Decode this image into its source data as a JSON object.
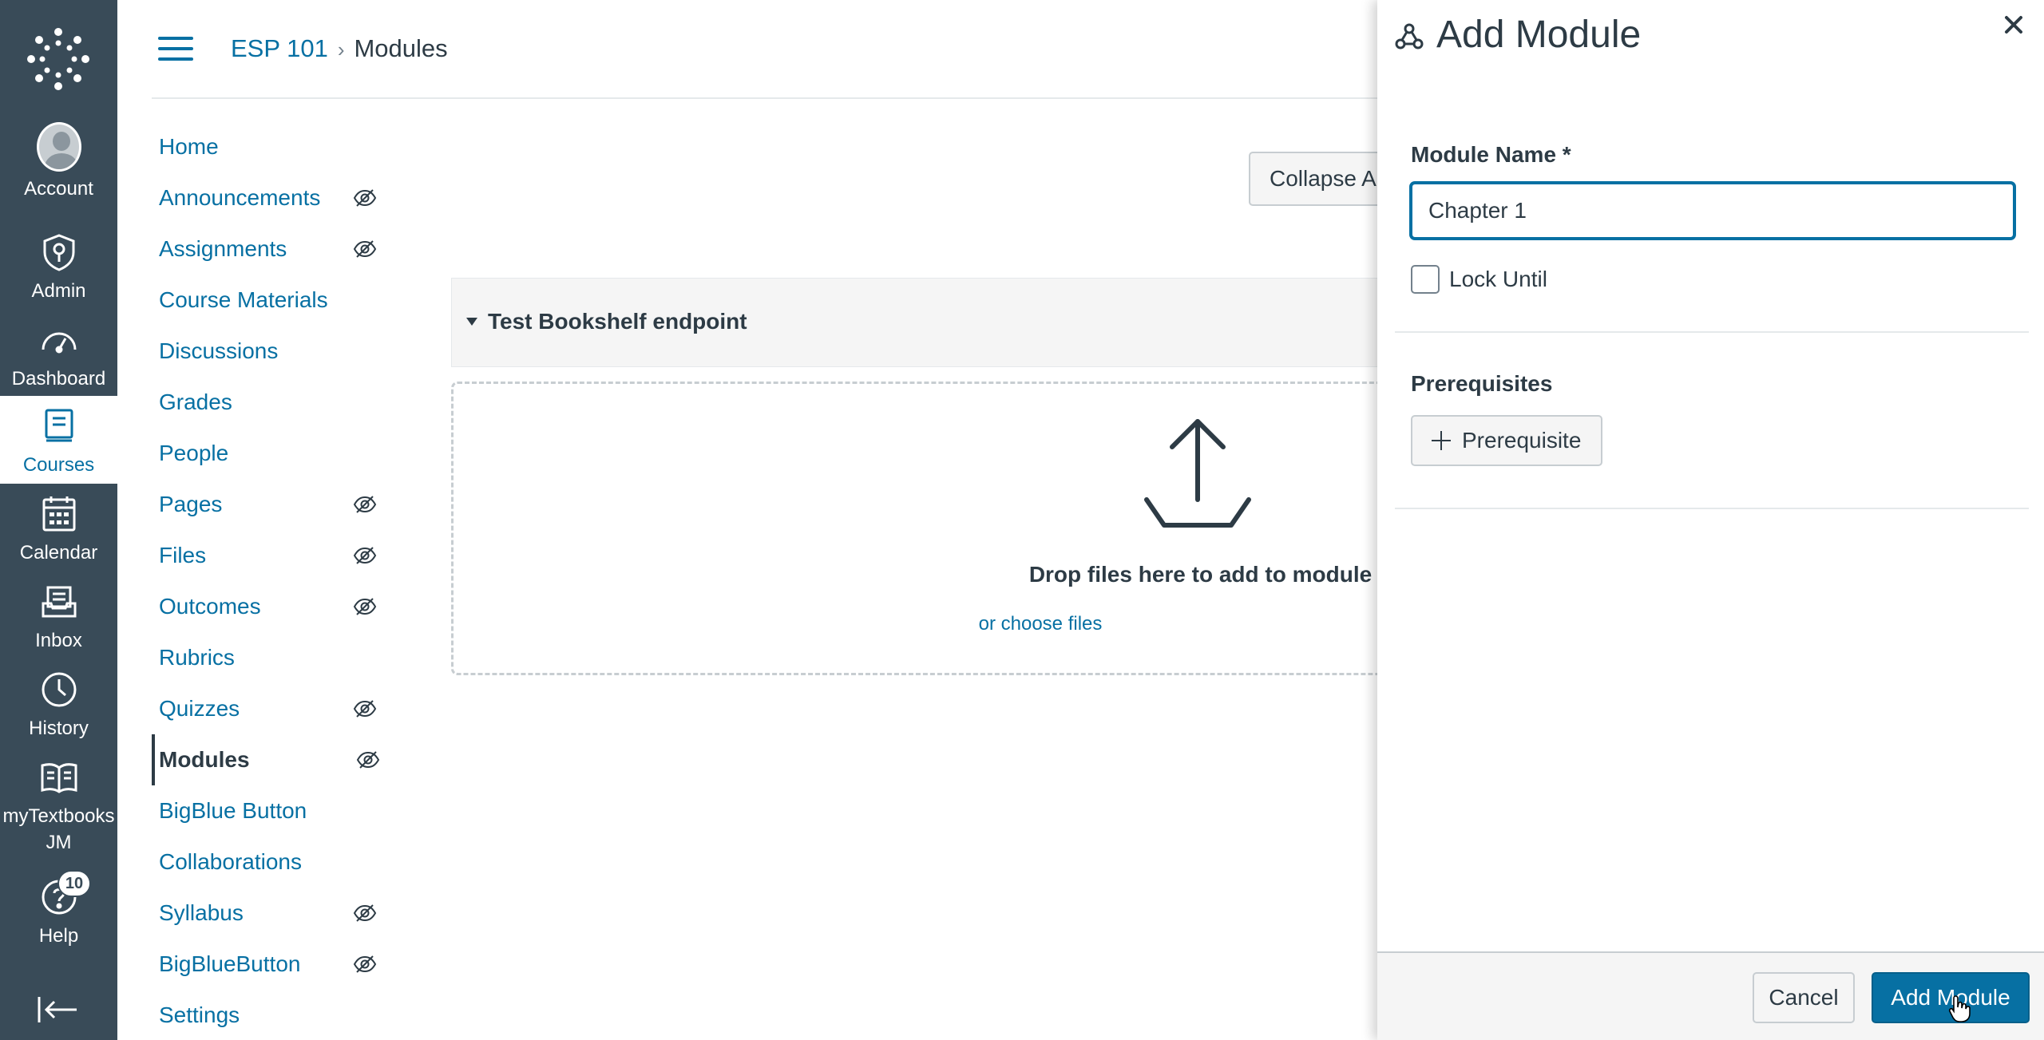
{
  "global_nav": {
    "account": "Account",
    "admin": "Admin",
    "dashboard": "Dashboard",
    "courses": "Courses",
    "calendar": "Calendar",
    "inbox": "Inbox",
    "history": "History",
    "mytextbooks_line1": "myTextbooks",
    "mytextbooks_line2": "JM",
    "help": "Help",
    "help_badge": "10"
  },
  "breadcrumb": {
    "course": "ESP 101",
    "separator": "›",
    "current": "Modules"
  },
  "course_nav": {
    "items": [
      {
        "label": "Home",
        "hidden": false
      },
      {
        "label": "Announcements",
        "hidden": true
      },
      {
        "label": "Assignments",
        "hidden": true
      },
      {
        "label": "Course Materials",
        "hidden": false
      },
      {
        "label": "Discussions",
        "hidden": false
      },
      {
        "label": "Grades",
        "hidden": false
      },
      {
        "label": "People",
        "hidden": false
      },
      {
        "label": "Pages",
        "hidden": true
      },
      {
        "label": "Files",
        "hidden": true
      },
      {
        "label": "Outcomes",
        "hidden": true
      },
      {
        "label": "Rubrics",
        "hidden": false
      },
      {
        "label": "Quizzes",
        "hidden": true
      },
      {
        "label": "Modules",
        "hidden": true,
        "active": true
      },
      {
        "label": "BigBlue Button",
        "hidden": false
      },
      {
        "label": "Collaborations",
        "hidden": false
      },
      {
        "label": "Syllabus",
        "hidden": true
      },
      {
        "label": "BigBlueButton",
        "hidden": true
      },
      {
        "label": "Settings",
        "hidden": false
      }
    ]
  },
  "main": {
    "collapse_all_label": "Collapse All",
    "module_title": "Test Bookshelf endpoint",
    "drop_text": "Drop files here to add to module",
    "choose_files": "or choose files"
  },
  "tray": {
    "title": "Add Module",
    "module_name_label": "Module Name *",
    "module_name_value": "Chapter 1",
    "lock_until_label": "Lock Until",
    "prerequisites_label": "Prerequisites",
    "prerequisite_button": "Prerequisite",
    "cancel_button": "Cancel",
    "add_button": "Add Module"
  },
  "colors": {
    "nav_bg": "#394b58",
    "link": "#0770a3",
    "text": "#2d3b45"
  }
}
